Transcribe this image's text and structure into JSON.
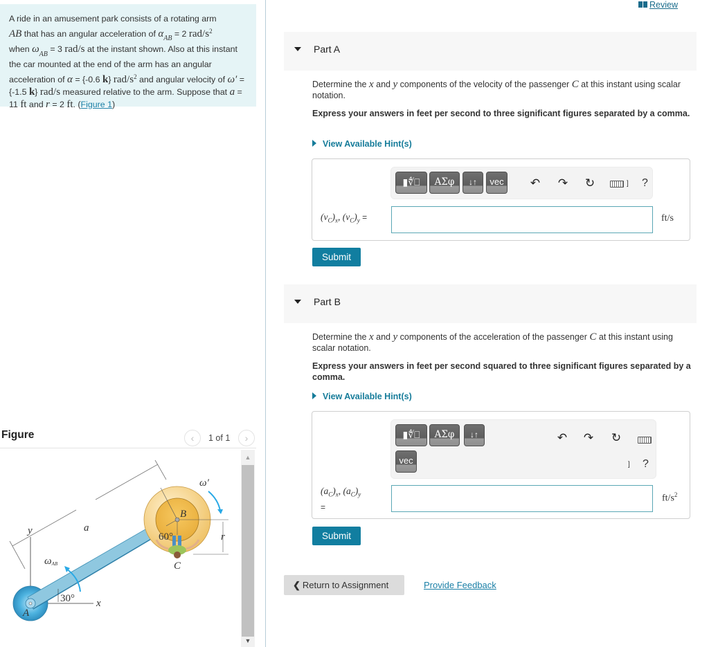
{
  "problem": {
    "text_1": "A ride in an amusement park consists of a rotating arm",
    "arm_symbol": "AB",
    "text_2": " that has an angular acceleration of ",
    "alpha_symbol": "α",
    "alpha_sub": "AB",
    "alpha_value": " = 2 ",
    "alpha_unit": "rad/s",
    "alpha_unit_exp": "2",
    "text_3": "when ",
    "omega_symbol": "ω",
    "omega_sub": "AB",
    "omega_value": " = 3 ",
    "omega_unit": "rad/s",
    "text_4": " at the instant shown. Also at this instant the car mounted at the end of the arm has an angular acceleration of ",
    "alpha2_symbol": "α",
    "alpha2_value": " = {-0.6 ",
    "k_symbol": "k",
    "alpha2_close": "} ",
    "alpha2_unit": "rad/s",
    "alpha2_unit_exp": "2",
    "text_5": " and angular velocity of ",
    "omega2_symbol": "ω′",
    "omega2_value": " = {-1.5 ",
    "omega2_close": "} ",
    "omega2_unit": "rad/s",
    "text_6": " measured relative to the arm. Suppose that ",
    "a_symbol": "a",
    "a_value": " = 11 ",
    "a_unit": "ft",
    "text_7": " and ",
    "r_symbol": "r",
    "r_value": " = 2 ",
    "r_unit": "ft",
    "text_8": ". (",
    "figure_link": "Figure 1",
    "text_9": ")"
  },
  "figure": {
    "title": "Figure",
    "counter": "1 of 1",
    "prev_icon": "‹",
    "next_icon": "›",
    "labels": {
      "y_axis": "y",
      "x_axis": "x",
      "a": "a",
      "omega_ab": "ω",
      "omega_ab_sub": "AB",
      "omega_prime": "ω′",
      "B": "B",
      "C": "C",
      "A": "A",
      "r": "r",
      "angle_30": "30°",
      "angle_60": "60°"
    },
    "colors": {
      "arm": "#8fc8e0",
      "hub": "#4eb3e0",
      "wheel_outer": "#f6d99a",
      "wheel_inner": "#edb64a",
      "arrow": "#29a9e6"
    }
  },
  "header": {
    "review_label": "Review"
  },
  "partA": {
    "title": "Part A",
    "question_1": "Determine the ",
    "x": "x",
    "and": " and ",
    "y": "y",
    "question_2": " components of the velocity of the passenger ",
    "C": "C",
    "question_3": " at this instant using scalar notation.",
    "instructions": "Express your answers in feet per second to three significant figures separated by a comma.",
    "hint_label": "View Available Hint(s)",
    "answer_label": "(vC)x, (vC)y =",
    "label_v": "v",
    "label_sub_c": "C",
    "label_sub_x": "x",
    "label_sub_y": "y",
    "input_value": "",
    "unit": "ft/s",
    "submit_label": "Submit"
  },
  "partB": {
    "title": "Part B",
    "question_1": "Determine the ",
    "x": "x",
    "and": " and ",
    "y": "y",
    "question_2": " components of the acceleration of the passenger ",
    "C": "C",
    "question_3": " at this instant using scalar notation.",
    "instructions": "Express your answers in feet per second squared to three significant figures separated by a comma.",
    "hint_label": "View Available Hint(s)",
    "label_a": "a",
    "label_sub_c": "C",
    "label_sub_x": "x",
    "label_sub_y": "y",
    "input_value": "",
    "unit": "ft/s",
    "unit_exp": "2",
    "submit_label": "Submit"
  },
  "toolbar": {
    "templates_icon": "▮∜⎕",
    "greek_label": "ΑΣφ",
    "arrows_label": "↓↑",
    "vec_label": "vec",
    "undo_icon": "↶",
    "redo_icon": "↷",
    "reset_icon": "↻",
    "keyboard_suffix": "]",
    "help_label": "?"
  },
  "footer": {
    "return_label": "Return to Assignment",
    "return_chevron": "❮",
    "feedback_label": "Provide Feedback"
  },
  "colors": {
    "accent": "#117ea0",
    "link": "#1a7fa6",
    "problem_bg": "#e5f4f6",
    "part_header_bg": "#f7f7f7"
  }
}
